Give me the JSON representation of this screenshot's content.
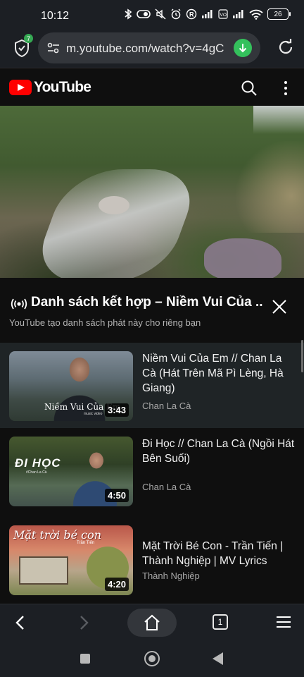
{
  "status_bar": {
    "time": "10:12",
    "battery": "26",
    "icons": [
      "bluetooth-icon",
      "toggle-icon",
      "mute-icon",
      "alarm-icon",
      "r-icon",
      "signal-icon",
      "volte-icon",
      "signal-icon",
      "wifi-icon",
      "battery-icon"
    ]
  },
  "browser": {
    "shield_badge": "7",
    "url": "m.youtube.com/watch?v=4gC",
    "colors": {
      "download": "#34c15c",
      "badge": "#35a853"
    }
  },
  "youtube": {
    "logo_text": "YouTube",
    "brand_color": "#ff0000"
  },
  "playlist": {
    "title": "Danh sách kết hợp – Niềm Vui Của ...",
    "subtitle": "YouTube tạo danh sách phát này cho riêng bạn"
  },
  "videos": [
    {
      "title": "Niềm Vui Của Em // Chan La Cà (Hát Trên Mã Pì Lèng, Hà Giang)",
      "channel": "Chan La Cà",
      "duration": "3:43",
      "thumb_caption": "Niềm Vui Của Em",
      "thumb_small": "music video"
    },
    {
      "title": "Đi Học // Chan La Cà (Ngồi Hát Bên Suối)",
      "channel": "Chan La Cà",
      "duration": "4:50",
      "thumb_caption": "ĐI HỌC",
      "thumb_small": "#Chan La Cà"
    },
    {
      "title": "Mặt Trời Bé Con - Trần Tiến | Thành Nghiệp | MV Lyrics",
      "channel": "Thành Nghiệp",
      "duration": "4:20",
      "thumb_caption": "Mặt trời bé con",
      "thumb_small": "Trần Tiến"
    }
  ],
  "bottom_bar": {
    "tab_count": "1"
  }
}
